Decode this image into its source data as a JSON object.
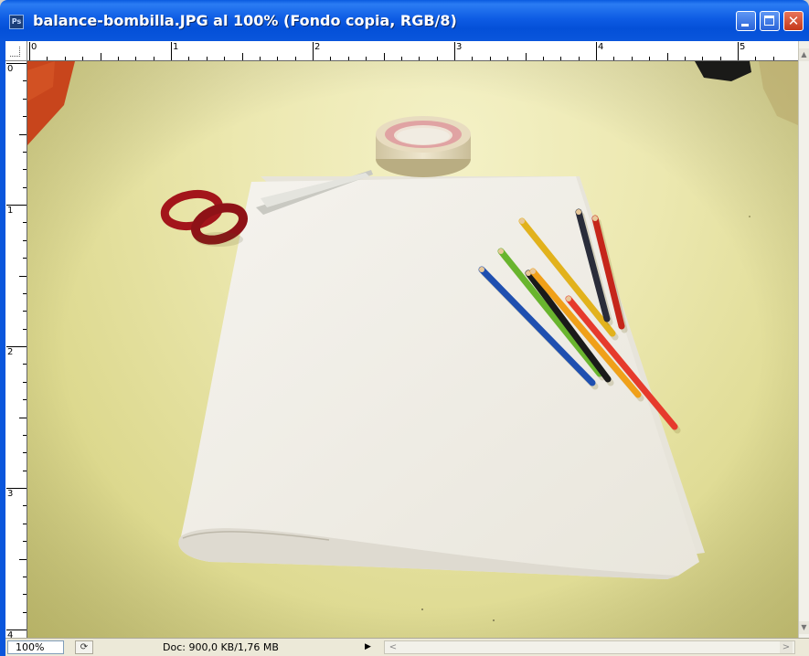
{
  "window": {
    "title": "balance-bombilla.JPG al 100% (Fondo copia, RGB/8)",
    "app_icon_label": "Ps",
    "controls": [
      "minimize",
      "maximize",
      "close"
    ]
  },
  "rulers": {
    "top_labels": [
      "0",
      "1",
      "2",
      "3",
      "4",
      "5"
    ],
    "left_labels": [
      "0",
      "1",
      "2",
      "3",
      "4"
    ]
  },
  "canvas": {
    "image_subject": "photo",
    "colors": {
      "desk": "#e9e5a8",
      "paper": "#f3f1ea",
      "scissors_handle": "#a3151b",
      "tape": "#e9dcc0"
    },
    "pencils": [
      {
        "color": "#e2b21c"
      },
      {
        "color": "#2a2d3a"
      },
      {
        "color": "#c5261b"
      },
      {
        "color": "#1f4fb0"
      },
      {
        "color": "#69b52e"
      },
      {
        "color": "#1a1a1a"
      },
      {
        "color": "#f0a019"
      },
      {
        "color": "#e63a2c"
      }
    ]
  },
  "statusbar": {
    "zoom": "100%",
    "doc_info": "Doc: 900,0 KB/1,76 MB",
    "menu_arrow": "▶",
    "scroll_left": "<",
    "scroll_right": ">"
  },
  "icons": {
    "minimize": "minimize-icon",
    "maximize": "maximize-icon",
    "close": "close-icon",
    "navigator": "navigator-icon",
    "status_menu": "triangle-right-icon"
  }
}
